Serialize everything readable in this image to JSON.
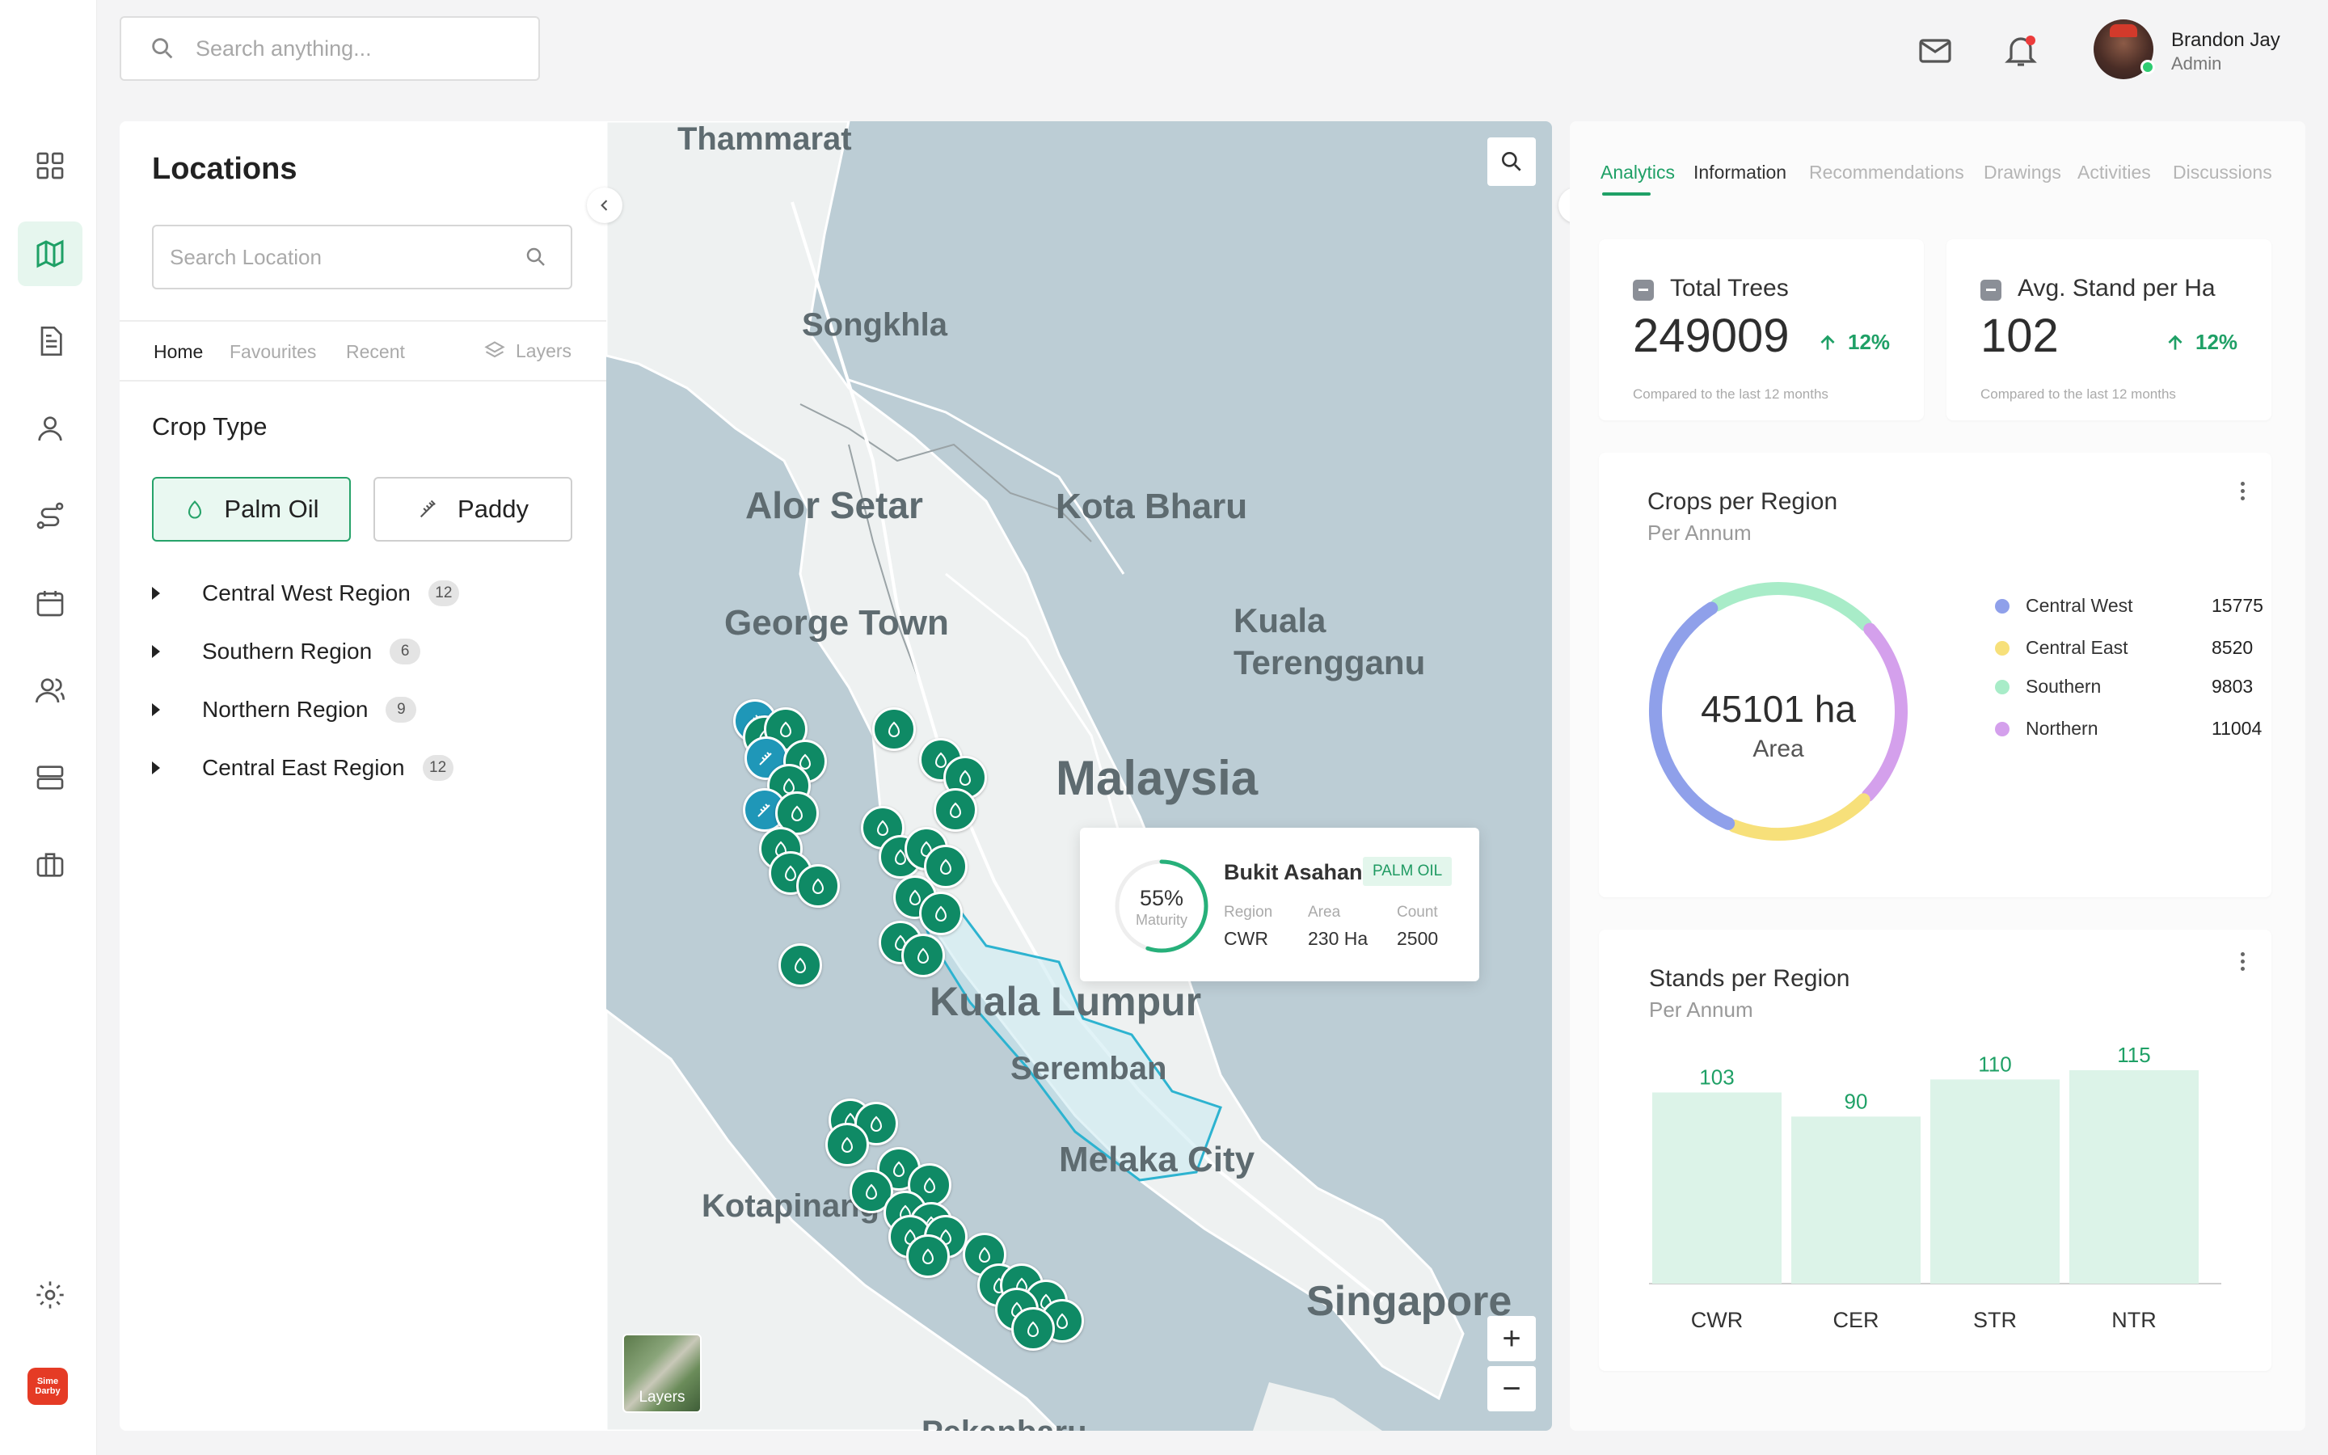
{
  "search": {
    "placeholder": "Search anything..."
  },
  "user": {
    "name": "Brandon Jay",
    "role": "Admin"
  },
  "sidebar": {
    "items": [
      {
        "icon": "dashboard-icon"
      },
      {
        "icon": "map-icon",
        "active": true
      },
      {
        "icon": "document-icon"
      },
      {
        "icon": "user-icon"
      },
      {
        "icon": "route-icon"
      },
      {
        "icon": "calendar-icon"
      },
      {
        "icon": "team-icon"
      },
      {
        "icon": "server-icon"
      },
      {
        "icon": "briefcase-icon"
      },
      {
        "icon": "gear-icon"
      }
    ],
    "logo_text": "Sime Darby"
  },
  "locations": {
    "title": "Locations",
    "search_placeholder": "Search Location",
    "tabs": [
      "Home",
      "Favourites",
      "Recent"
    ],
    "layers_label": "Layers",
    "crop_type_title": "Crop Type",
    "crop_buttons": [
      {
        "label": "Palm Oil",
        "active": true
      },
      {
        "label": "Paddy",
        "active": false
      }
    ],
    "regions": [
      {
        "name": "Central West Region",
        "count": "12"
      },
      {
        "name": "Southern Region",
        "count": "6"
      },
      {
        "name": "Northern Region",
        "count": "9"
      },
      {
        "name": "Central East Region",
        "count": "12"
      }
    ]
  },
  "map": {
    "place_labels": [
      "Thammarat",
      "Songkhla",
      "Alor Setar",
      "Kota Bharu",
      "George Town",
      "Kuala Terengganu",
      "Malaysia",
      "Kuala Lumpur",
      "Seremban",
      "Melaka City",
      "Kotapinang",
      "Singapore",
      "Pekanbaru"
    ],
    "layers_thumb_label": "Layers",
    "zoom_in": "+",
    "zoom_out": "−",
    "popup": {
      "name": "Bukit Asahan",
      "tag": "PALM OIL",
      "maturity_value": "55%",
      "maturity_fraction": 0.55,
      "maturity_label": "Maturity",
      "region_label": "Region",
      "region_value": "CWR",
      "area_label": "Area",
      "area_value": "230 Ha",
      "count_label": "Count",
      "count_value": "2500"
    }
  },
  "panel": {
    "tabs": [
      "Analytics",
      "Information",
      "Recommendations",
      "Drawings",
      "Activities",
      "Discussions"
    ],
    "active_tab": "Analytics",
    "stats": [
      {
        "title": "Total Trees",
        "value": "249009",
        "change": "12%",
        "note": "Compared to the last 12 months"
      },
      {
        "title": "Avg. Stand per Ha",
        "value": "102",
        "change": "12%",
        "note": "Compared to the last 12 months"
      }
    ],
    "crops_card": {
      "title": "Crops per Region",
      "subtitle": "Per Annum",
      "center_value": "45101 ha",
      "center_label": "Area"
    },
    "stands_card": {
      "title": "Stands per Region",
      "subtitle": "Per Annum"
    }
  },
  "colors": {
    "accent": "#1fa066",
    "marker": "#0f8a65",
    "paddy_marker": "#1f97b8",
    "bar": "#dcf3e8"
  },
  "chart_data": [
    {
      "type": "pie",
      "title": "Crops per Region",
      "subtitle": "Per Annum",
      "categories": [
        "Central West",
        "Central East",
        "Southern",
        "Northern"
      ],
      "values": [
        15775,
        8520,
        9803,
        11004
      ],
      "colors": [
        "#8fa0ea",
        "#f7e07a",
        "#a8ecc8",
        "#d4a0ec"
      ],
      "center_text": "45101 ha",
      "legend": "right"
    },
    {
      "type": "bar",
      "title": "Stands per Region",
      "subtitle": "Per Annum",
      "categories": [
        "CWR",
        "CER",
        "STR",
        "NTR"
      ],
      "values": [
        103,
        90,
        110,
        115
      ],
      "ylim": [
        0,
        135
      ],
      "grid": false
    }
  ]
}
